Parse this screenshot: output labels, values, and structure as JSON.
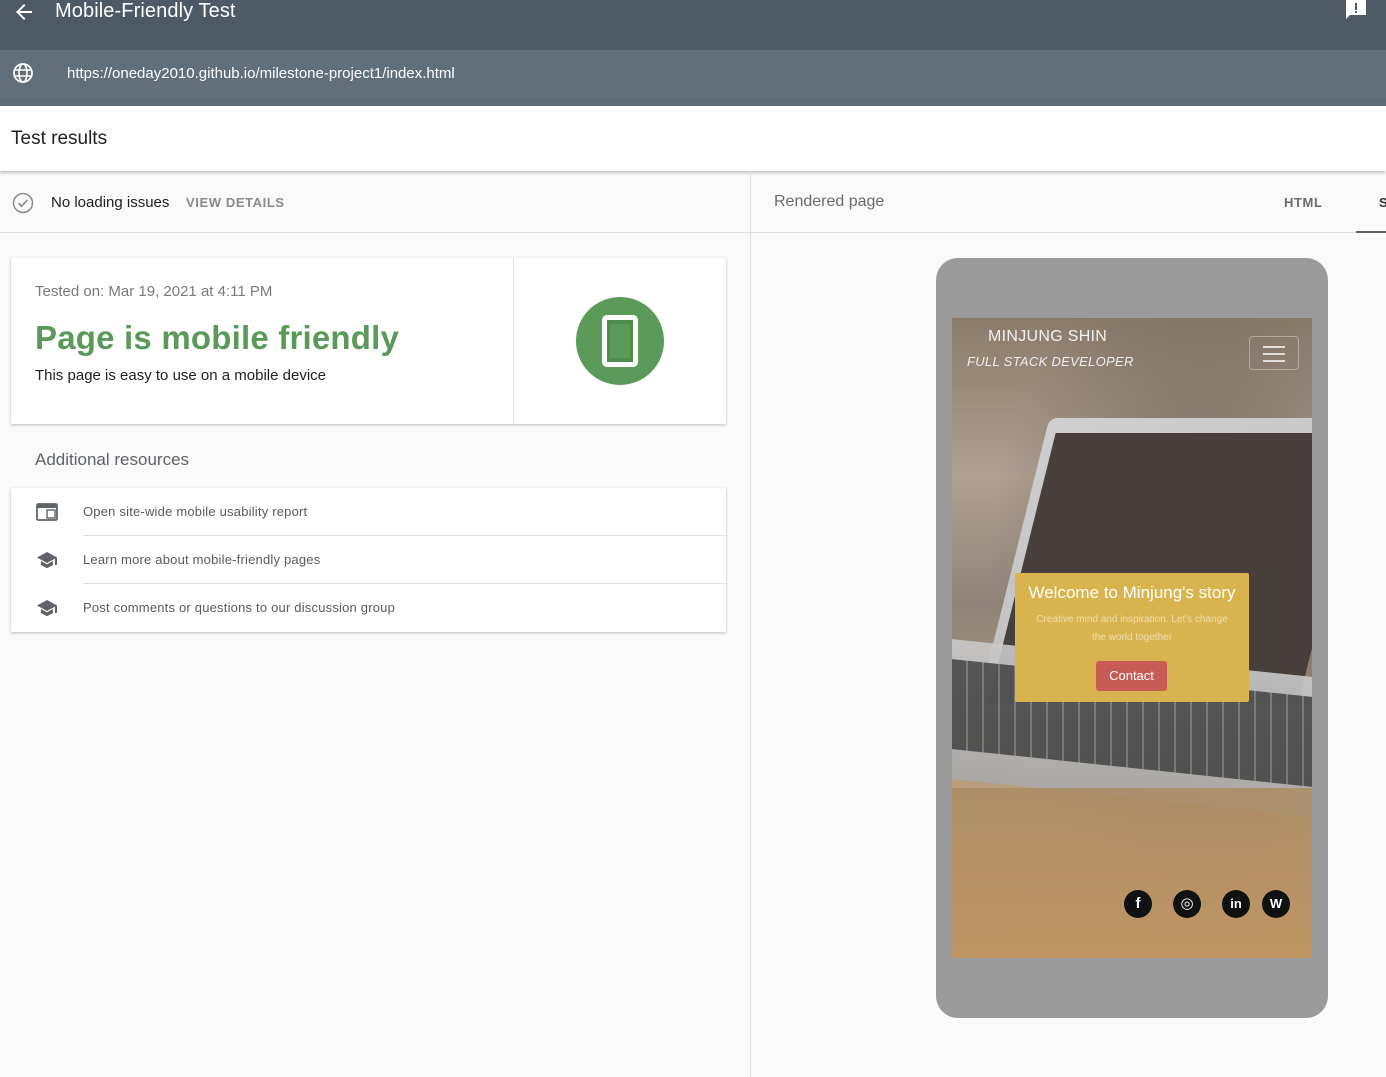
{
  "header": {
    "title": "Mobile-Friendly Test",
    "url": "https://oneday2010.github.io/milestone-project1/index.html"
  },
  "results": {
    "title": "Test results",
    "status": "No loading issues",
    "view_details": "VIEW DETAILS"
  },
  "card": {
    "tested_on": "Tested on: Mar 19, 2021 at 4:11 PM",
    "verdict": "Page is mobile friendly",
    "subtitle": "This page is easy to use on a mobile device",
    "accent": "#5a9a58"
  },
  "resources": {
    "heading": "Additional resources",
    "items": [
      {
        "label": "Open site-wide mobile usability report",
        "icon": "report-icon"
      },
      {
        "label": "Learn more about mobile-friendly pages",
        "icon": "school-icon"
      },
      {
        "label": "Post comments or questions to our discussion group",
        "icon": "school-icon"
      }
    ]
  },
  "rendered": {
    "title": "Rendered page",
    "tabs": [
      "HTML",
      "S"
    ]
  },
  "preview": {
    "site_name": "MINJUNG SHIN",
    "site_role": "FULL STACK DEVELOPER",
    "welcome_title": "Welcome to Minjung's story",
    "welcome_text": "Creative mind and inspiration. Let's change the world together",
    "contact": "Contact",
    "social": [
      "f",
      "◎",
      "in",
      "W"
    ]
  }
}
